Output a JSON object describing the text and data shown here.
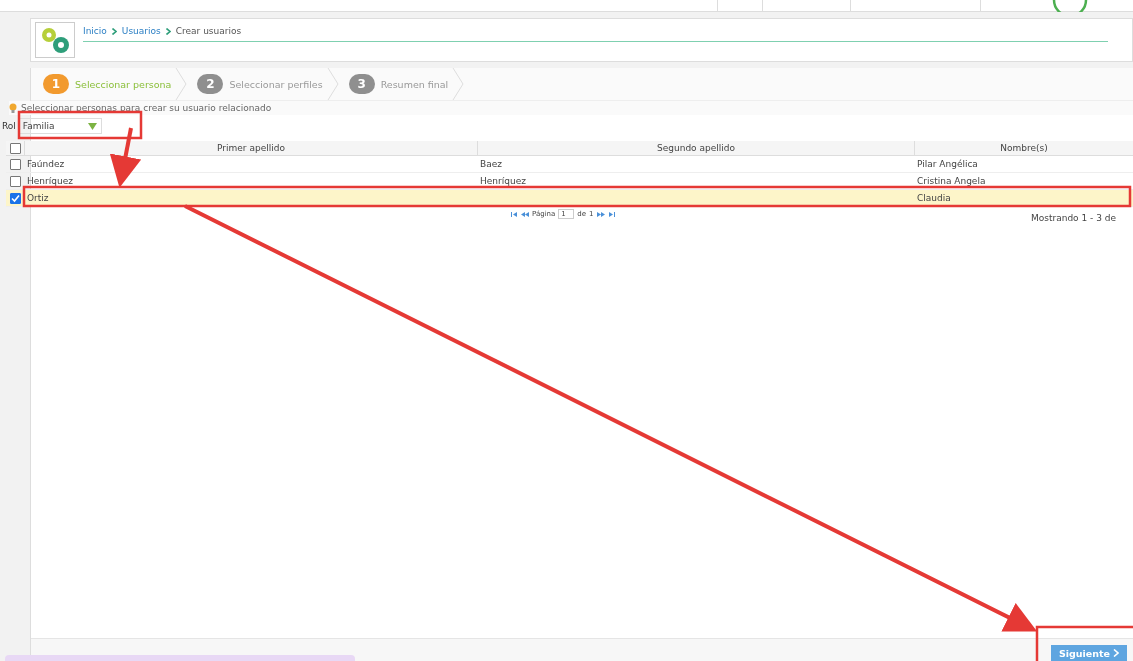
{
  "breadcrumb": [
    {
      "label": "Inicio",
      "link": true
    },
    {
      "label": "Usuarios",
      "link": true
    },
    {
      "label": "Crear usuarios",
      "link": false
    }
  ],
  "steps": [
    {
      "number": "1",
      "label": "Seleccionar persona",
      "selected": true
    },
    {
      "number": "2",
      "label": "Seleccionar perfiles",
      "selected": false
    },
    {
      "number": "3",
      "label": "Resumen final",
      "selected": false
    }
  ],
  "hint": "Seleccionar personas para crear su usuario relacionado",
  "role_filter": {
    "label": "Rol",
    "value": "Familia"
  },
  "table": {
    "select_all_checked": false,
    "columns": [
      "Primer apellido",
      "Segundo apellido",
      "Nombre(s)"
    ],
    "rows": [
      {
        "checked": false,
        "cells": [
          "Faúndez",
          "Baez",
          "Pilar Angélica"
        ]
      },
      {
        "checked": false,
        "cells": [
          "Henríquez",
          "Henríquez",
          "Cristina Angela"
        ]
      },
      {
        "checked": true,
        "cells": [
          "Ortiz",
          "",
          "Claudia"
        ]
      }
    ]
  },
  "pager": {
    "page_label": "Página",
    "page": "1",
    "of_label": "de",
    "total": "1"
  },
  "record_info": "Mostrando 1 - 3 de",
  "next_button": "Siguiente"
}
